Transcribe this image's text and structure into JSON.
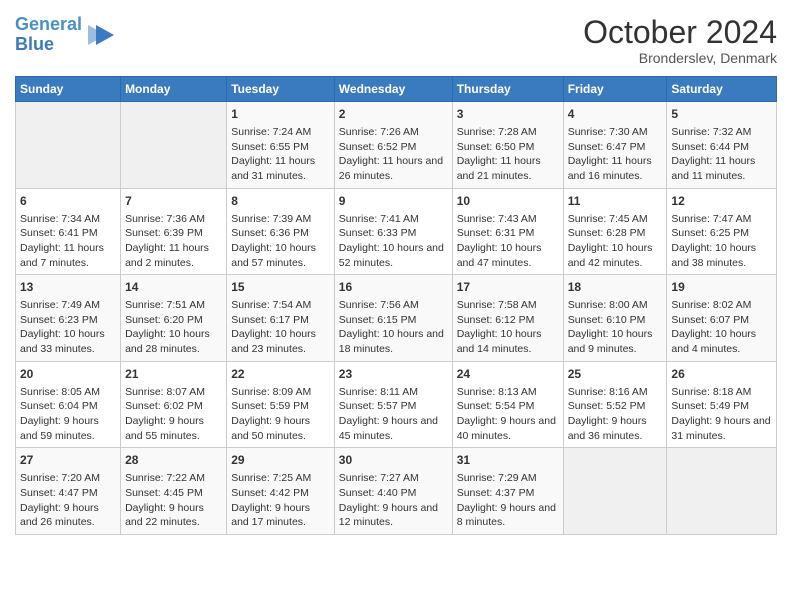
{
  "header": {
    "logo_line1": "General",
    "logo_line2": "Blue",
    "month": "October 2024",
    "location": "Bronderslev, Denmark"
  },
  "weekdays": [
    "Sunday",
    "Monday",
    "Tuesday",
    "Wednesday",
    "Thursday",
    "Friday",
    "Saturday"
  ],
  "weeks": [
    [
      {
        "day": "",
        "lines": []
      },
      {
        "day": "",
        "lines": []
      },
      {
        "day": "1",
        "lines": [
          "Sunrise: 7:24 AM",
          "Sunset: 6:55 PM",
          "Daylight: 11 hours and 31 minutes."
        ]
      },
      {
        "day": "2",
        "lines": [
          "Sunrise: 7:26 AM",
          "Sunset: 6:52 PM",
          "Daylight: 11 hours and 26 minutes."
        ]
      },
      {
        "day": "3",
        "lines": [
          "Sunrise: 7:28 AM",
          "Sunset: 6:50 PM",
          "Daylight: 11 hours and 21 minutes."
        ]
      },
      {
        "day": "4",
        "lines": [
          "Sunrise: 7:30 AM",
          "Sunset: 6:47 PM",
          "Daylight: 11 hours and 16 minutes."
        ]
      },
      {
        "day": "5",
        "lines": [
          "Sunrise: 7:32 AM",
          "Sunset: 6:44 PM",
          "Daylight: 11 hours and 11 minutes."
        ]
      }
    ],
    [
      {
        "day": "6",
        "lines": [
          "Sunrise: 7:34 AM",
          "Sunset: 6:41 PM",
          "Daylight: 11 hours and 7 minutes."
        ]
      },
      {
        "day": "7",
        "lines": [
          "Sunrise: 7:36 AM",
          "Sunset: 6:39 PM",
          "Daylight: 11 hours and 2 minutes."
        ]
      },
      {
        "day": "8",
        "lines": [
          "Sunrise: 7:39 AM",
          "Sunset: 6:36 PM",
          "Daylight: 10 hours and 57 minutes."
        ]
      },
      {
        "day": "9",
        "lines": [
          "Sunrise: 7:41 AM",
          "Sunset: 6:33 PM",
          "Daylight: 10 hours and 52 minutes."
        ]
      },
      {
        "day": "10",
        "lines": [
          "Sunrise: 7:43 AM",
          "Sunset: 6:31 PM",
          "Daylight: 10 hours and 47 minutes."
        ]
      },
      {
        "day": "11",
        "lines": [
          "Sunrise: 7:45 AM",
          "Sunset: 6:28 PM",
          "Daylight: 10 hours and 42 minutes."
        ]
      },
      {
        "day": "12",
        "lines": [
          "Sunrise: 7:47 AM",
          "Sunset: 6:25 PM",
          "Daylight: 10 hours and 38 minutes."
        ]
      }
    ],
    [
      {
        "day": "13",
        "lines": [
          "Sunrise: 7:49 AM",
          "Sunset: 6:23 PM",
          "Daylight: 10 hours and 33 minutes."
        ]
      },
      {
        "day": "14",
        "lines": [
          "Sunrise: 7:51 AM",
          "Sunset: 6:20 PM",
          "Daylight: 10 hours and 28 minutes."
        ]
      },
      {
        "day": "15",
        "lines": [
          "Sunrise: 7:54 AM",
          "Sunset: 6:17 PM",
          "Daylight: 10 hours and 23 minutes."
        ]
      },
      {
        "day": "16",
        "lines": [
          "Sunrise: 7:56 AM",
          "Sunset: 6:15 PM",
          "Daylight: 10 hours and 18 minutes."
        ]
      },
      {
        "day": "17",
        "lines": [
          "Sunrise: 7:58 AM",
          "Sunset: 6:12 PM",
          "Daylight: 10 hours and 14 minutes."
        ]
      },
      {
        "day": "18",
        "lines": [
          "Sunrise: 8:00 AM",
          "Sunset: 6:10 PM",
          "Daylight: 10 hours and 9 minutes."
        ]
      },
      {
        "day": "19",
        "lines": [
          "Sunrise: 8:02 AM",
          "Sunset: 6:07 PM",
          "Daylight: 10 hours and 4 minutes."
        ]
      }
    ],
    [
      {
        "day": "20",
        "lines": [
          "Sunrise: 8:05 AM",
          "Sunset: 6:04 PM",
          "Daylight: 9 hours and 59 minutes."
        ]
      },
      {
        "day": "21",
        "lines": [
          "Sunrise: 8:07 AM",
          "Sunset: 6:02 PM",
          "Daylight: 9 hours and 55 minutes."
        ]
      },
      {
        "day": "22",
        "lines": [
          "Sunrise: 8:09 AM",
          "Sunset: 5:59 PM",
          "Daylight: 9 hours and 50 minutes."
        ]
      },
      {
        "day": "23",
        "lines": [
          "Sunrise: 8:11 AM",
          "Sunset: 5:57 PM",
          "Daylight: 9 hours and 45 minutes."
        ]
      },
      {
        "day": "24",
        "lines": [
          "Sunrise: 8:13 AM",
          "Sunset: 5:54 PM",
          "Daylight: 9 hours and 40 minutes."
        ]
      },
      {
        "day": "25",
        "lines": [
          "Sunrise: 8:16 AM",
          "Sunset: 5:52 PM",
          "Daylight: 9 hours and 36 minutes."
        ]
      },
      {
        "day": "26",
        "lines": [
          "Sunrise: 8:18 AM",
          "Sunset: 5:49 PM",
          "Daylight: 9 hours and 31 minutes."
        ]
      }
    ],
    [
      {
        "day": "27",
        "lines": [
          "Sunrise: 7:20 AM",
          "Sunset: 4:47 PM",
          "Daylight: 9 hours and 26 minutes."
        ]
      },
      {
        "day": "28",
        "lines": [
          "Sunrise: 7:22 AM",
          "Sunset: 4:45 PM",
          "Daylight: 9 hours and 22 minutes."
        ]
      },
      {
        "day": "29",
        "lines": [
          "Sunrise: 7:25 AM",
          "Sunset: 4:42 PM",
          "Daylight: 9 hours and 17 minutes."
        ]
      },
      {
        "day": "30",
        "lines": [
          "Sunrise: 7:27 AM",
          "Sunset: 4:40 PM",
          "Daylight: 9 hours and 12 minutes."
        ]
      },
      {
        "day": "31",
        "lines": [
          "Sunrise: 7:29 AM",
          "Sunset: 4:37 PM",
          "Daylight: 9 hours and 8 minutes."
        ]
      },
      {
        "day": "",
        "lines": []
      },
      {
        "day": "",
        "lines": []
      }
    ]
  ]
}
